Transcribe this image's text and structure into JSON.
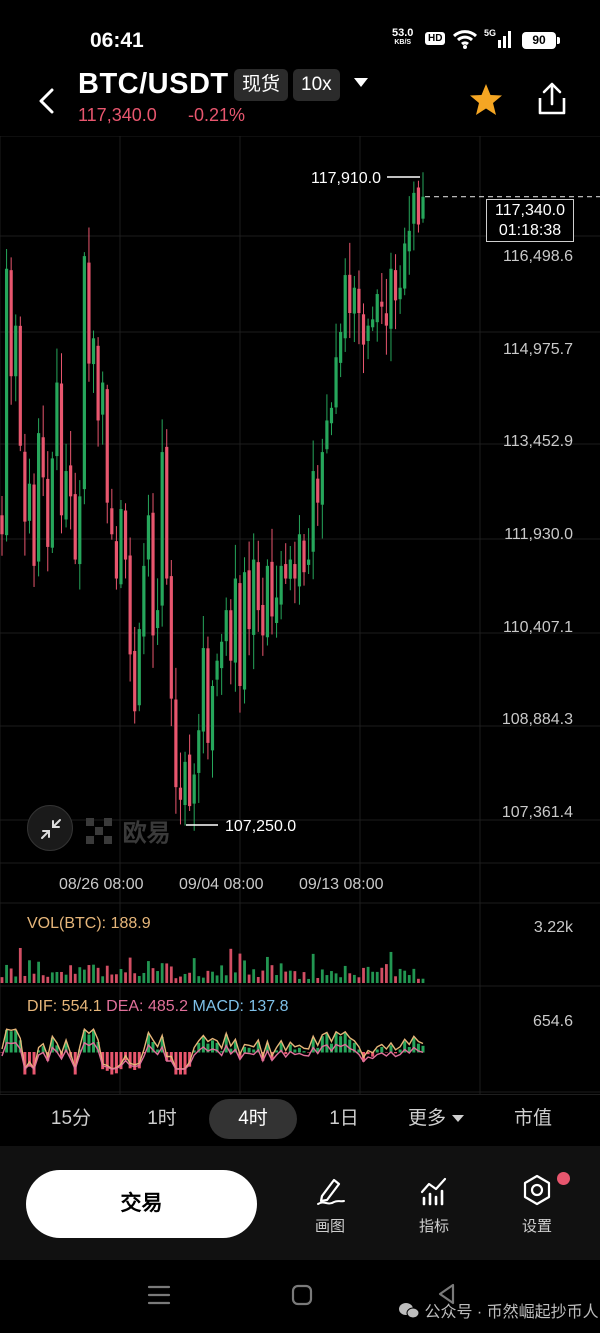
{
  "status_bar": {
    "time": "06:41",
    "net_speed": "53.0",
    "net_unit": "KB/S",
    "hd": "HD",
    "signal": "5G",
    "battery": "90"
  },
  "header": {
    "pair": "BTC/USDT",
    "market_type": "现货",
    "leverage": "10x",
    "last_price": "117,340.0",
    "change_pct": "-0.21%"
  },
  "chart": {
    "price_axis": [
      "116,498.6",
      "114,975.7",
      "113,452.9",
      "111,930.0",
      "110,407.1",
      "108,884.3",
      "107,361.4"
    ],
    "current_price": "117,340.0",
    "countdown": "01:18:38",
    "high_label": "117,910.0",
    "low_label": "107,250.0",
    "dates": [
      "08/26 08:00",
      "09/04 08:00",
      "09/13 08:00"
    ],
    "logo_text": "欧易",
    "colors": {
      "up": "#26a65b",
      "down": "#e8566e",
      "grid": "#1d1d1d"
    }
  },
  "volume": {
    "title": "VOL(BTC): 188.9",
    "max": "3.22k"
  },
  "macd": {
    "dif": "DIF: 554.1",
    "dea": "DEA: 485.2",
    "macd": "MACD: 137.8",
    "max": "654.6"
  },
  "timeframes": {
    "t15m": "15分",
    "t1h": "1时",
    "t4h": "4时",
    "t1d": "1日",
    "more": "更多",
    "mktcap": "市值"
  },
  "bottom_bar": {
    "trade": "交易",
    "draw": "画图",
    "indicators": "指标",
    "settings": "设置"
  },
  "watermark": "公众号 · 币然崛起抄币人",
  "chart_data": {
    "type": "candlestick",
    "title": "BTC/USDT 4时",
    "x_labels": [
      "08/26 08:00",
      "09/04 08:00",
      "09/13 08:00"
    ],
    "ylim": [
      106800,
      118300
    ],
    "y_ticks": [
      116498.6,
      114975.7,
      113452.9,
      111930.0,
      110407.1,
      108884.3,
      107361.4
    ],
    "high": 117910.0,
    "low": 107250.0,
    "last": 117340.0,
    "close_path": [
      112000,
      116200,
      114500,
      115300,
      113400,
      112200,
      112800,
      111500,
      113600,
      112900,
      111800,
      113200,
      114400,
      112300,
      113000,
      112600,
      111600,
      112600,
      116400,
      114700,
      115100,
      113800,
      114400,
      112500,
      112000,
      111300,
      112400,
      111600,
      110100,
      109200,
      110500,
      111500,
      112300,
      110400,
      110800,
      113300,
      111300,
      109400,
      108000,
      107800,
      108400,
      107700,
      108200,
      108900,
      110200,
      108700,
      109600,
      110000,
      110300,
      110800,
      110000,
      111300,
      109600,
      111400,
      110500,
      111600,
      110800,
      110400,
      111500,
      110700,
      111000,
      111500,
      111300,
      111600,
      111300,
      112000,
      111400,
      111600,
      113000,
      112500,
      113300,
      113800,
      114000,
      114800,
      115200,
      116100,
      115500,
      115900,
      115500,
      115000,
      115300,
      115400,
      115800,
      115600,
      115300,
      116200,
      115700,
      115900,
      116600,
      116800,
      117400,
      116900,
      117340
    ],
    "volume_max": 3220,
    "volume_last": 188.9,
    "macd_last": {
      "DIF": 554.1,
      "DEA": 485.2,
      "MACD": 137.8
    },
    "macd_max": 654.6
  }
}
